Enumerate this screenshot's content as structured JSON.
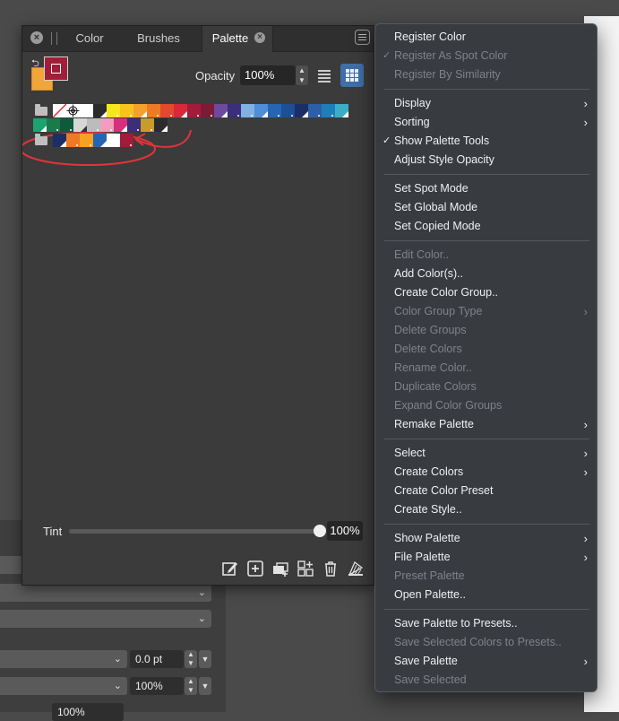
{
  "panel": {
    "tabs": [
      "Color",
      "Brushes",
      "Palette"
    ],
    "active_tab": "Palette",
    "close_glyph": "×",
    "opacity_label": "Opacity",
    "opacity_value": "100%",
    "tint_label": "Tint",
    "tint_value": "100%",
    "tint_level": 1.0,
    "colors": {
      "fill": "#f2a63a",
      "stroke": "#a01e38",
      "accent": "#3f6ea8"
    },
    "rows": [
      {
        "swatches": [
          "none",
          "registration",
          "#ffffff",
          "#2b2b2b",
          "#f5e61e",
          "#f7c31c",
          "#f4a12a",
          "#ee7a25",
          "#e4492b",
          "#d8283a",
          "#a31b3a",
          "#7b1b36",
          "#6e4a9e",
          "#3b2e7a",
          "#7fb1e3",
          "#4d8ed6",
          "#2565b5",
          "#1d4f95",
          "#1c2e66",
          "#2c5fa8",
          "#1e7fb8",
          "#3aaec8"
        ]
      },
      {
        "swatches": [
          "#1ba371",
          "#1a7a4a",
          "#0f5a3a",
          "#d7d7d7",
          "#bcbcbc",
          "#f19cc0",
          "#d6307c",
          "#3b2e7a",
          "#c99b2a",
          "#2b2b2b"
        ]
      },
      {
        "swatches": [
          "#1c2e66",
          "#ee7a25",
          "#f7a121",
          "#2565b5",
          "#ffffff",
          "#a31b3a"
        ]
      }
    ],
    "tools": [
      "edit-color-icon",
      "add-color-icon",
      "add-group-icon",
      "create-preset-icon",
      "delete-icon",
      "remake-palette-icon"
    ]
  },
  "background": {
    "field_pt": "0.0 pt",
    "field_pct_1": "100%",
    "field_pct_2": "100%"
  },
  "menu": {
    "items": [
      {
        "label": "Register Color",
        "enabled": true
      },
      {
        "label": "Register As Spot Color",
        "enabled": false,
        "checked": true
      },
      {
        "label": "Register By Similarity",
        "enabled": false
      },
      {
        "sep": true
      },
      {
        "label": "Display",
        "enabled": true,
        "submenu": true
      },
      {
        "label": "Sorting",
        "enabled": true,
        "submenu": true
      },
      {
        "label": "Show Palette Tools",
        "enabled": true,
        "checked": true
      },
      {
        "label": "Adjust Style Opacity",
        "enabled": true
      },
      {
        "sep": true
      },
      {
        "label": "Set Spot Mode",
        "enabled": true
      },
      {
        "label": "Set Global Mode",
        "enabled": true
      },
      {
        "label": "Set Copied Mode",
        "enabled": true
      },
      {
        "sep": true
      },
      {
        "label": "Edit Color..",
        "enabled": false
      },
      {
        "label": "Add Color(s)..",
        "enabled": true
      },
      {
        "label": "Create Color Group..",
        "enabled": true
      },
      {
        "label": "Color Group Type",
        "enabled": false,
        "submenu": true
      },
      {
        "label": "Delete Groups",
        "enabled": false
      },
      {
        "label": "Delete Colors",
        "enabled": false
      },
      {
        "label": "Rename Color..",
        "enabled": false
      },
      {
        "label": "Duplicate Colors",
        "enabled": false
      },
      {
        "label": "Expand Color Groups",
        "enabled": false
      },
      {
        "label": "Remake Palette",
        "enabled": true,
        "submenu": true
      },
      {
        "sep": true
      },
      {
        "label": "Select",
        "enabled": true,
        "submenu": true
      },
      {
        "label": "Create Colors",
        "enabled": true,
        "submenu": true
      },
      {
        "label": "Create Color Preset",
        "enabled": true
      },
      {
        "label": "Create Style..",
        "enabled": true
      },
      {
        "sep": true
      },
      {
        "label": "Show Palette",
        "enabled": true,
        "submenu": true
      },
      {
        "label": "File Palette",
        "enabled": true,
        "submenu": true
      },
      {
        "label": "Preset Palette",
        "enabled": false
      },
      {
        "label": "Open Palette..",
        "enabled": true
      },
      {
        "sep": true
      },
      {
        "label": "Save Palette to Presets..",
        "enabled": true
      },
      {
        "label": "Save Selected Colors to Presets..",
        "enabled": false
      },
      {
        "label": "Save Palette",
        "enabled": true,
        "submenu": true
      },
      {
        "label": "Save Selected",
        "enabled": false
      }
    ],
    "check_glyph": "✓",
    "submenu_glyph": "›"
  },
  "annotation_color": "#e0343a"
}
